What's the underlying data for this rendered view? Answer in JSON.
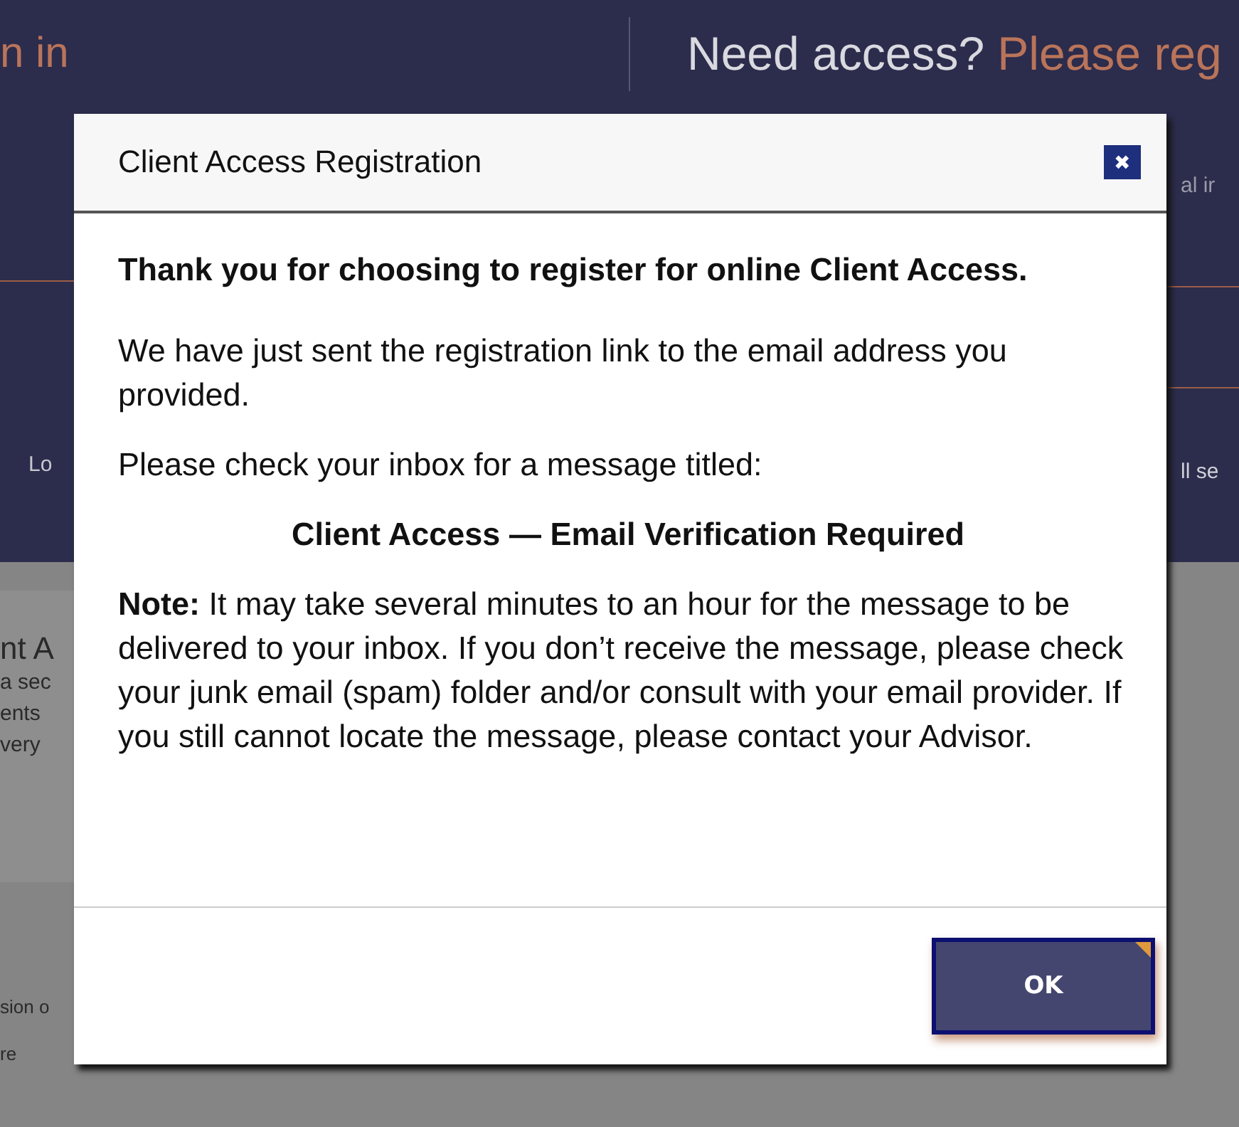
{
  "background": {
    "sign_in_fragment": "n in",
    "access_question": "Need access?",
    "register_fragment": "Please reg",
    "right_fragments": [
      "al ir",
      "ll se"
    ],
    "left_nav_fragment": "Lo",
    "left_panel_fragments": [
      "nt A",
      "a sec",
      "ents",
      "very"
    ],
    "left_lower_fragments": [
      "sion o",
      "re"
    ]
  },
  "dialog": {
    "title": "Client Access Registration",
    "close_icon": "✖",
    "heading": "Thank you for choosing to register for online Client Access.",
    "paragraphs": [
      "We have just sent the registration link to the email address you provided.",
      "Please check your inbox for a message titled:"
    ],
    "subject": "Client Access — Email Verification Required",
    "note": "**Note:** It may take several minutes to an hour for the message to be delivered to your inbox. If you don’t receive the message, please check your junk email (spam) folder and/or consult with your email provider. If you still cannot locate the message, please contact your Advisor.",
    "buttons": [
      {
        "label": "OK",
        "focused": true
      }
    ]
  }
}
